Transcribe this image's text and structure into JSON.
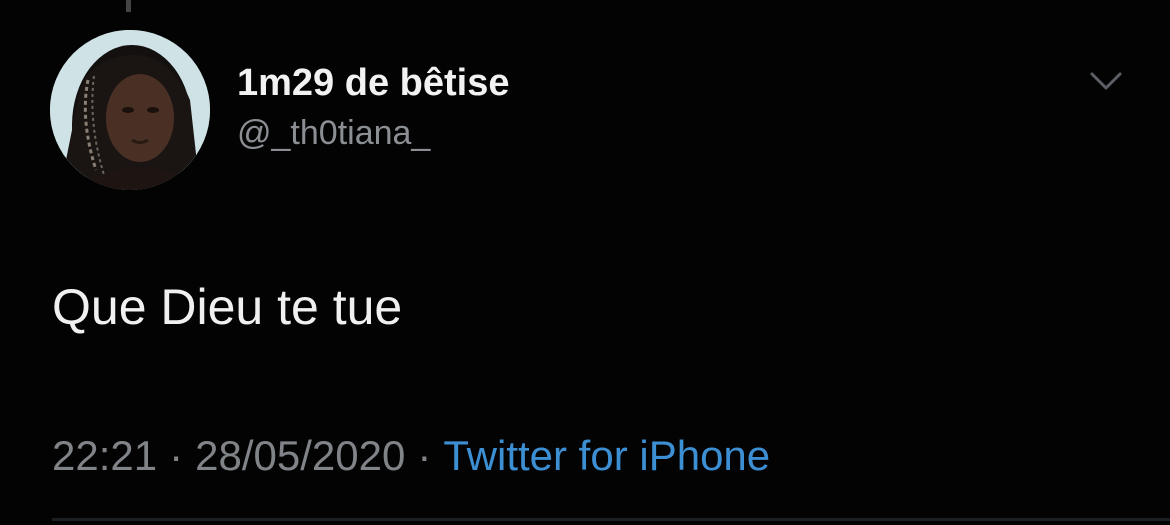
{
  "user": {
    "display_name": "1m29 de bêtise",
    "handle": "@_th0tiana_"
  },
  "tweet": {
    "text": "Que Dieu te tue",
    "time": "22:21",
    "date": "28/05/2020",
    "separator": "·",
    "source": "Twitter for iPhone"
  },
  "icons": {
    "menu": "chevron-down-icon",
    "avatar": "profile-photo"
  },
  "colors": {
    "background": "#030303",
    "text": "#f0f0f0",
    "muted": "#808489",
    "link": "#3d8fd4"
  }
}
